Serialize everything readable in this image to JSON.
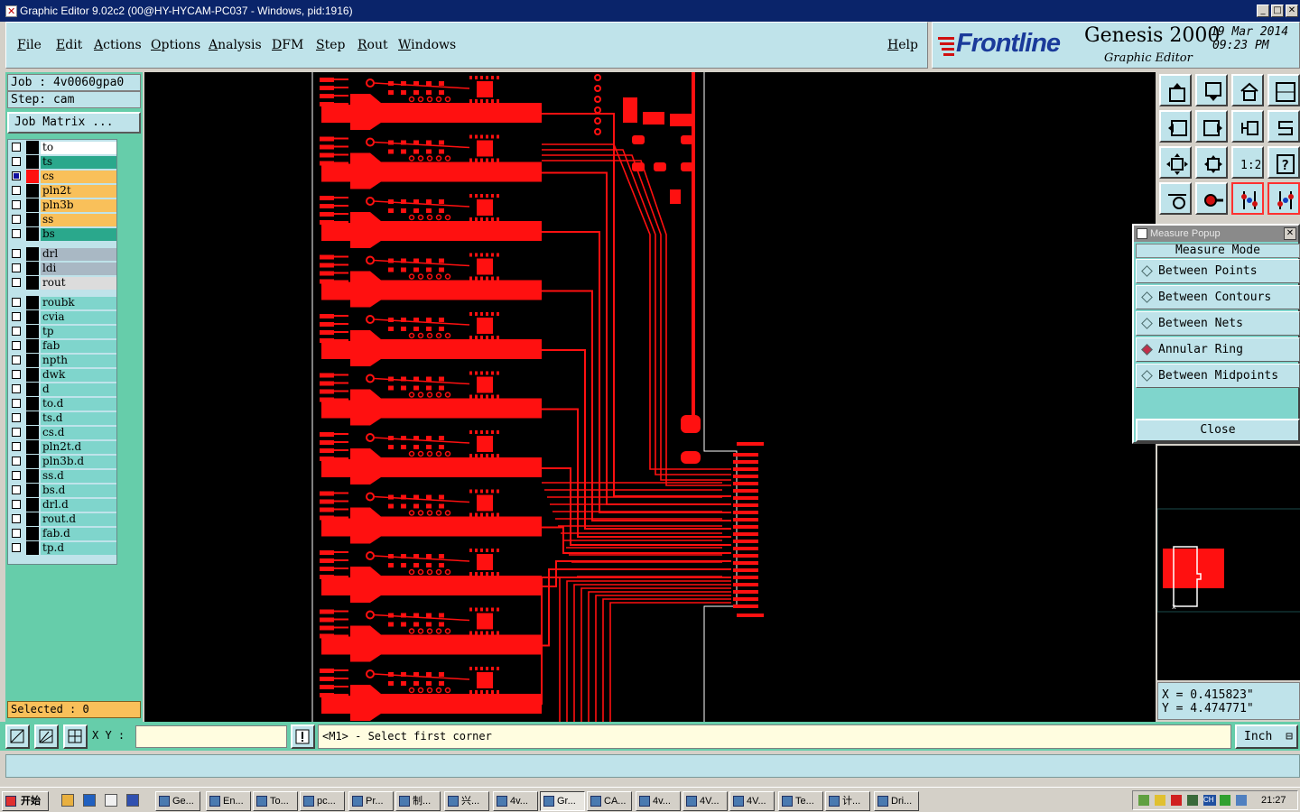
{
  "window": {
    "title": "Graphic Editor 9.02c2 (00@HY-HYCAM-PC037 - Windows, pid:1916)",
    "controls": [
      "_",
      "□",
      "✕"
    ]
  },
  "menu": {
    "items": [
      "File",
      "Edit",
      "Actions",
      "Options",
      "Analysis",
      "DFM",
      "Step",
      "Rout",
      "Windows"
    ],
    "help": "Help"
  },
  "brand": {
    "company": "Frontline",
    "product": "Genesis 2000",
    "subtitle": "Graphic Editor",
    "date": "19 Mar 2014",
    "time": "09:23 PM"
  },
  "job": {
    "job_label": "Job : 4v0060gpa0",
    "step_label": "Step: cam",
    "matrix_button": "Job Matrix ..."
  },
  "layers": [
    {
      "name": "to",
      "checked": false,
      "color": "#000000",
      "bg": "#ffffff",
      "tick": ""
    },
    {
      "name": "ts",
      "checked": false,
      "color": "#000000",
      "bg": "#2aa88c",
      "tick": ""
    },
    {
      "name": "cs",
      "checked": true,
      "color": "#ff1010",
      "bg": "#f9c05a",
      "tick": "▪"
    },
    {
      "name": "pln2t",
      "checked": false,
      "color": "#000000",
      "bg": "#f9c05a",
      "tick": "✓"
    },
    {
      "name": "pln3b",
      "checked": false,
      "color": "#000000",
      "bg": "#f9c05a",
      "tick": "✓"
    },
    {
      "name": "ss",
      "checked": false,
      "color": "#000000",
      "bg": "#f9c05a",
      "tick": "✓"
    },
    {
      "name": "bs",
      "checked": false,
      "color": "#000000",
      "bg": "#2aa88c",
      "tick": ""
    },
    {
      "name": "drl",
      "checked": false,
      "color": "#000000",
      "bg": "#a9b8c4",
      "tick": ""
    },
    {
      "name": "ldi",
      "checked": false,
      "color": "#000000",
      "bg": "#a9b8c4",
      "tick": ""
    },
    {
      "name": "rout",
      "checked": false,
      "color": "#000000",
      "bg": "#dcdcdc",
      "tick": ""
    },
    {
      "name": "roubk",
      "checked": false,
      "color": "#000000",
      "bg": "#7fd5cc",
      "tick": ""
    },
    {
      "name": "cvia",
      "checked": false,
      "color": "#000000",
      "bg": "#7fd5cc",
      "tick": ""
    },
    {
      "name": "tp",
      "checked": false,
      "color": "#000000",
      "bg": "#7fd5cc",
      "tick": ""
    },
    {
      "name": "fab",
      "checked": false,
      "color": "#000000",
      "bg": "#7fd5cc",
      "tick": ""
    },
    {
      "name": "npth",
      "checked": false,
      "color": "#000000",
      "bg": "#7fd5cc",
      "tick": ""
    },
    {
      "name": "dwk",
      "checked": false,
      "color": "#000000",
      "bg": "#7fd5cc",
      "tick": ""
    },
    {
      "name": "d",
      "checked": false,
      "color": "#000000",
      "bg": "#7fd5cc",
      "tick": ""
    },
    {
      "name": "to.d",
      "checked": false,
      "color": "#000000",
      "bg": "#7fd5cc",
      "tick": ""
    },
    {
      "name": "ts.d",
      "checked": false,
      "color": "#000000",
      "bg": "#7fd5cc",
      "tick": ""
    },
    {
      "name": "cs.d",
      "checked": false,
      "color": "#000000",
      "bg": "#7fd5cc",
      "tick": ""
    },
    {
      "name": "pln2t.d",
      "checked": false,
      "color": "#000000",
      "bg": "#7fd5cc",
      "tick": "✓"
    },
    {
      "name": "pln3b.d",
      "checked": false,
      "color": "#000000",
      "bg": "#7fd5cc",
      "tick": "✓"
    },
    {
      "name": "ss.d",
      "checked": false,
      "color": "#000000",
      "bg": "#7fd5cc",
      "tick": "✓"
    },
    {
      "name": "bs.d",
      "checked": false,
      "color": "#000000",
      "bg": "#7fd5cc",
      "tick": ""
    },
    {
      "name": "drl.d",
      "checked": false,
      "color": "#000000",
      "bg": "#7fd5cc",
      "tick": ""
    },
    {
      "name": "rout.d",
      "checked": false,
      "color": "#000000",
      "bg": "#7fd5cc",
      "tick": ""
    },
    {
      "name": "fab.d",
      "checked": false,
      "color": "#000000",
      "bg": "#7fd5cc",
      "tick": ""
    },
    {
      "name": "tp.d",
      "checked": false,
      "color": "#000000",
      "bg": "#7fd5cc",
      "tick": ""
    }
  ],
  "selected": "Selected : 0",
  "toolbar_icons": [
    "copy-up-icon",
    "copy-down-icon",
    "home-icon",
    "panel-icon",
    "prev-icon",
    "next-icon",
    "undo-icon",
    "step-icon",
    "fit-icon",
    "zoom-icon",
    "ratio-icon",
    "help-icon",
    "tools-icon",
    "probe-icon",
    "layer-up-icon",
    "layer-down-icon"
  ],
  "toolbar_ratio_label": "1:2",
  "toolbar_help_label": "?",
  "measure": {
    "title": "Measure Popup",
    "mode_label": "Measure Mode",
    "options": [
      "Between Points",
      "Between Contours",
      "Between Nets",
      "Annular Ring",
      "Between Midpoints"
    ],
    "selected_option": "Annular Ring",
    "close": "Close"
  },
  "coords": {
    "x": "X = 0.415823\"",
    "y": "Y = 4.474771\""
  },
  "command": {
    "xy_label": "X Y :",
    "xy_value": "",
    "prompt": "<M1> - Select first corner",
    "units": "Inch"
  },
  "taskbar": {
    "start": "开始",
    "tasks": [
      "Ge...",
      "En...",
      "To...",
      "pc...",
      "Pr...",
      "制...",
      "兴...",
      "4v...",
      "Gr...",
      "CA...",
      "4v...",
      "4V...",
      "4V...",
      "Te...",
      "计...",
      "Dri..."
    ],
    "active_task": "Gr...",
    "tray_lang": "CH",
    "clock": "21:27"
  },
  "colors": {
    "pcb": "#ff1010",
    "panel": "#66cdaa",
    "light": "#bfe3ea",
    "highlight": "#f9c05a"
  }
}
